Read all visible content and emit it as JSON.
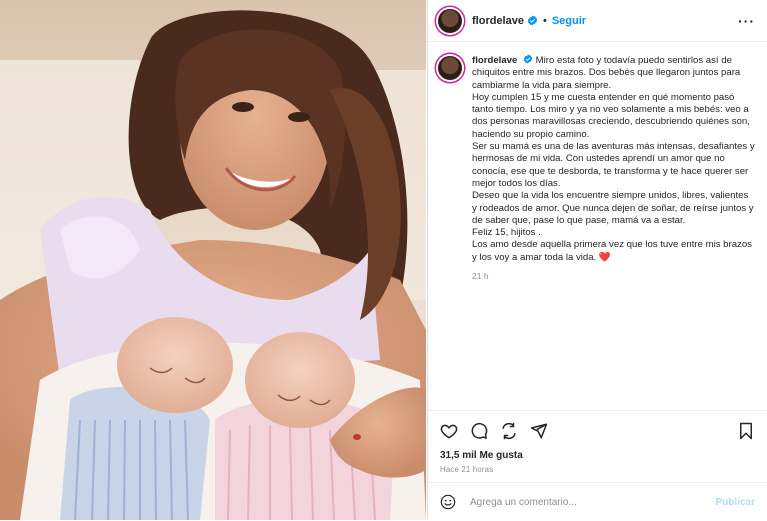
{
  "post": {
    "username": "flordelave",
    "follow_label": "Seguir",
    "dot": "•",
    "more_label": "···",
    "caption_paragraphs": [
      "Miro esta foto y todavía puedo sentirlos así de chiquitos entre mis brazos. Dos bebés que llegaron juntos para cambiarme la vida para siempre.",
      "Hoy cumplen 15 y me cuesta entender en qué momento pasó tanto tiempo. Los miro y ya no veo solamente a mis bebés: veo a dos personas maravillosas creciendo, descubriendo quiénes son, haciendo su propio camino.",
      "Ser su mamá es una de las aventuras más intensas, desafiantes y hermosas de mi vida. Con ustedes aprendí un amor que no conocía, ese que te desborda, te transforma y te hace querer ser mejor todos los días.",
      "Deseo que la vida los encuentre siempre unidos, libres, valientes y rodeados de amor. Que nunca dejen de soñar, de reírse juntos y de saber que, pase lo que pase, mamá va a estar.",
      "Feliz 15, hijitos .",
      "Los amo desde aquella primera vez que los tuve entre mis brazos y los voy a amar toda la vida. ❤️"
    ],
    "time_ago": "21 h",
    "likes": "31,5 mil Me gusta",
    "posted": "Hace 21 horas",
    "comment_placeholder": "Agrega un comentario...",
    "publish_label": "Publicar"
  },
  "icons": {
    "verified": "verified-badge-icon",
    "like": "heart-icon",
    "comment": "comment-icon",
    "share": "share-icon",
    "send": "send-icon",
    "save": "bookmark-icon",
    "emoji": "emoji-icon"
  },
  "colors": {
    "accent": "#0095f6",
    "publish_disabled": "#b3dbff",
    "muted": "#8e8e8e"
  }
}
